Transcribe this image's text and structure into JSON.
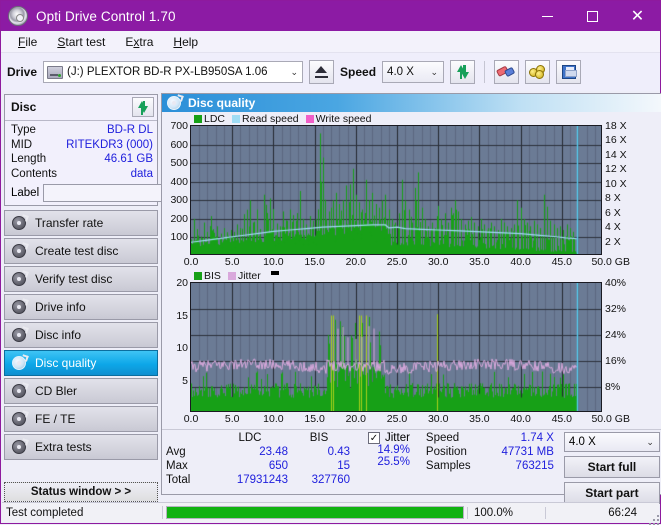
{
  "window": {
    "title": "Opti Drive Control 1.70",
    "icon": "disc-icon",
    "minimize_label": "minimize",
    "maximize_label": "maximize",
    "close_label": "close",
    "accent_color": "#8c1ba4"
  },
  "menu": {
    "items": [
      {
        "label": "File",
        "mnemonic": "F"
      },
      {
        "label": "Start test",
        "mnemonic": "S"
      },
      {
        "label": "Extra",
        "mnemonic": "x"
      },
      {
        "label": "Help",
        "mnemonic": "H"
      }
    ]
  },
  "toolbar": {
    "drive_label": "Drive",
    "drive_value": "(J:)   PLEXTOR BD-R  PX-LB950SA 1.06",
    "eject_title": "Eject",
    "speed_label": "Speed",
    "speed_value": "4.0 X",
    "refresh_title": "Refresh",
    "erase_title": "Erase disc",
    "coins_title": "Bitsetting",
    "save_title": "Save"
  },
  "sidebar": {
    "disc_panel": {
      "title": "Disc",
      "refresh_icon": "refresh-icon",
      "rows": [
        {
          "key": "Type",
          "value": "BD-R DL"
        },
        {
          "key": "MID",
          "value": "RITEKDR3 (000)"
        },
        {
          "key": "Length",
          "value": "46.61 GB"
        },
        {
          "key": "Contents",
          "value": "data"
        }
      ],
      "label_key": "Label",
      "label_value": "",
      "label_placeholder": "",
      "disc_icon": "disc-icon"
    },
    "items": [
      {
        "label": "Transfer rate",
        "active": false
      },
      {
        "label": "Create test disc",
        "active": false
      },
      {
        "label": "Verify test disc",
        "active": false
      },
      {
        "label": "Drive info",
        "active": false
      },
      {
        "label": "Disc info",
        "active": false
      },
      {
        "label": "Disc quality",
        "active": true
      },
      {
        "label": "CD Bler",
        "active": false
      },
      {
        "label": "FE / TE",
        "active": false
      },
      {
        "label": "Extra tests",
        "active": false
      }
    ],
    "status_window_button": "Status window > >"
  },
  "panel": {
    "title": "Disc quality",
    "icon": "disc-quality-icon"
  },
  "stats": {
    "columns": [
      "LDC",
      "BIS"
    ],
    "rows": [
      {
        "label": "Avg",
        "ldc": "23.48",
        "bis": "0.43",
        "jitter": "14.9%"
      },
      {
        "label": "Max",
        "ldc": "650",
        "bis": "15",
        "jitter": "25.5%"
      },
      {
        "label": "Total",
        "ldc": "17931243",
        "bis": "327760",
        "jitter": ""
      }
    ],
    "jitter_label": "Jitter",
    "jitter_checked": true,
    "jitter_check_glyph": "✓",
    "speed_label": "Speed",
    "speed_value": "1.74 X",
    "position_label": "Position",
    "position_value": "47731 MB",
    "samples_label": "Samples",
    "samples_value": "763215",
    "speed_select_value": "4.0 X",
    "start_full_label": "Start full",
    "start_part_label": "Start part"
  },
  "statusbar": {
    "text": "Test completed",
    "progress_percent": 100.0,
    "percent_label": "100.0%",
    "elapsed": "66:24"
  },
  "chart_data": [
    {
      "id": "ldc-chart",
      "type": "area",
      "title": "",
      "xlabel": "GB",
      "ylabel": "LDC",
      "xlim": [
        0,
        50
      ],
      "ylim": [
        0,
        700
      ],
      "y2lim": [
        0,
        18
      ],
      "y2label": "X",
      "grid": true,
      "legend_position": "top-left",
      "legend": [
        {
          "name": "LDC",
          "color": "#17a017"
        },
        {
          "name": "Read speed",
          "color": "#9fdcf4"
        },
        {
          "name": "Write speed",
          "color": "#f060c8"
        }
      ],
      "xticks": [
        "0.0",
        "5.0",
        "10.0",
        "15.0",
        "20.0",
        "25.0",
        "30.0",
        "35.0",
        "40.0",
        "45.0",
        "50.0 GB"
      ],
      "yticks": [
        "700",
        "600",
        "500",
        "400",
        "300",
        "200",
        "100"
      ],
      "y2ticks": [
        "18 X",
        "16 X",
        "14 X",
        "12 X",
        "10 X",
        "8 X",
        "6 X",
        "4 X",
        "2 X"
      ],
      "plot_background": "#6b7b95",
      "series": [
        {
          "name": "LDC",
          "color": "#17a017",
          "render": "spikes",
          "x": [
            0.0,
            0.4,
            0.8,
            1.2,
            1.6,
            2.0,
            2.4,
            2.8,
            3.2,
            3.6,
            4.0,
            4.4,
            4.8,
            5.2,
            5.6,
            6.0,
            6.4,
            6.8,
            7.2,
            7.6,
            8.0,
            8.4,
            8.8,
            9.2,
            9.6,
            10.0,
            10.4,
            10.8,
            11.2,
            11.6,
            12.0,
            12.4,
            12.8,
            13.2,
            13.6,
            14.0,
            14.4,
            14.8,
            15.2,
            15.6,
            16.0,
            16.4,
            16.8,
            17.0,
            17.2,
            17.6,
            18.0,
            18.4,
            18.8,
            19.2,
            19.6,
            20.0,
            20.4,
            20.8,
            21.2,
            21.6,
            22.0,
            22.4,
            22.8,
            23.2,
            23.6,
            24.0,
            24.4,
            24.8,
            25.2,
            25.6,
            26.0,
            26.4,
            26.8,
            27.2,
            27.6,
            28.0,
            28.4,
            28.8,
            29.2,
            29.6,
            30.0,
            30.4,
            30.8,
            31.2,
            31.6,
            32.0,
            32.4,
            32.8,
            33.2,
            33.6,
            34.0,
            34.4,
            34.8,
            35.2,
            35.6,
            36.0,
            36.4,
            36.8,
            37.2,
            37.6,
            38.0,
            38.4,
            38.8,
            39.2,
            39.6,
            40.0,
            40.4,
            40.8,
            41.2,
            41.6,
            42.0,
            42.4,
            42.8,
            43.2,
            43.6,
            44.0,
            44.4,
            44.8,
            45.2,
            45.6,
            46.0,
            46.4,
            46.8
          ],
          "baseline": [
            70,
            75,
            70,
            68,
            72,
            70,
            75,
            72,
            78,
            74,
            80,
            76,
            82,
            80,
            84,
            82,
            86,
            84,
            88,
            86,
            90,
            92,
            88,
            94,
            92,
            96,
            98,
            95,
            100,
            102,
            105,
            103,
            108,
            106,
            110,
            112,
            115,
            118,
            120,
            122,
            125,
            130,
            128,
            135,
            140,
            138,
            142,
            145,
            148,
            150,
            152,
            155,
            158,
            160,
            162,
            165,
            168,
            170,
            172,
            175,
            60,
            70,
            68,
            72,
            70,
            66,
            68,
            72,
            70,
            66,
            68,
            64,
            66,
            62,
            64,
            60,
            62,
            58,
            60,
            62,
            58,
            60,
            56,
            58,
            54,
            56,
            52,
            54,
            50,
            52,
            48,
            50,
            46,
            48,
            44,
            46,
            42,
            44,
            40,
            42,
            38,
            40,
            36,
            38,
            34,
            36,
            32,
            34,
            30,
            32,
            28,
            30,
            26,
            28,
            24,
            26,
            22,
            24,
            20
          ],
          "peaks": [
            90,
            200,
            110,
            105,
            180,
            130,
            215,
            125,
            160,
            118,
            150,
            128,
            140,
            130,
            170,
            150,
            225,
            140,
            300,
            160,
            250,
            145,
            330,
            190,
            310,
            200,
            175,
            160,
            240,
            190,
            250,
            220,
            190,
            350,
            200,
            170,
            215,
            190,
            200,
            660,
            530,
            200,
            240,
            260,
            300,
            340,
            280,
            300,
            380,
            290,
            470,
            330,
            290,
            250,
            410,
            300,
            340,
            280,
            260,
            300,
            330,
            250,
            200,
            180,
            230,
            410,
            300,
            250,
            180,
            210,
            450,
            260,
            200,
            160,
            180,
            150,
            270,
            200,
            230,
            180,
            260,
            300,
            240,
            200,
            170,
            190,
            210,
            180,
            160,
            200,
            170,
            150,
            180,
            160,
            140,
            200,
            180,
            160,
            150,
            170,
            300,
            260,
            200,
            180,
            160,
            190,
            170,
            150,
            330,
            200,
            190,
            170,
            150,
            160,
            140,
            170,
            150,
            130,
            120
          ]
        },
        {
          "name": "Read speed",
          "color": "#9fdcf4",
          "render": "line",
          "x": [
            0.0,
            2.0,
            4.0,
            6.0,
            8.0,
            10.0,
            12.0,
            14.0,
            16.0,
            18.0,
            20.0,
            22.0,
            23.6,
            24.0,
            25.0,
            26.0,
            28.0,
            30.0,
            32.0,
            34.0,
            36.0,
            38.0,
            40.0,
            42.0,
            44.0,
            45.5,
            46.8,
            46.9
          ],
          "y_speed": [
            1.9,
            2.2,
            2.5,
            2.8,
            3.1,
            3.4,
            3.6,
            3.8,
            4.0,
            4.1,
            4.2,
            4.3,
            4.3,
            3.9,
            4.0,
            3.8,
            3.7,
            3.6,
            3.5,
            3.4,
            3.3,
            3.2,
            3.1,
            2.9,
            2.7,
            2.5,
            2.4,
            18.0
          ]
        }
      ],
      "cursor_marker": {
        "x": 46.9,
        "color": "#55cdf0"
      }
    },
    {
      "id": "bis-jitter-chart",
      "type": "area",
      "title": "",
      "xlabel": "GB",
      "ylabel": "BIS",
      "xlim": [
        0,
        50
      ],
      "ylim": [
        0,
        20
      ],
      "y2lim": [
        0,
        40
      ],
      "y2label": "%",
      "grid": true,
      "legend_position": "top-left",
      "legend": [
        {
          "name": "BIS",
          "color": "#17a017"
        },
        {
          "name": "Jitter",
          "color": "#d9a8dc"
        }
      ],
      "xticks": [
        "0.0",
        "5.0",
        "10.0",
        "15.0",
        "20.0",
        "25.0",
        "30.0",
        "35.0",
        "40.0",
        "45.0",
        "50.0 GB"
      ],
      "yticks": [
        "20",
        "15",
        "10",
        "5"
      ],
      "y2ticks": [
        "40%",
        "32%",
        "24%",
        "16%",
        "8%"
      ],
      "plot_background": "#6b7b95",
      "series": [
        {
          "name": "BIS",
          "color": "#17a017",
          "render": "spikes",
          "baseline_level": 4.2,
          "peak_level": 5.2,
          "noisy_region": [
            16.5,
            23.5
          ],
          "noisy_peak_level": 9.0
        },
        {
          "name": "Jitter",
          "color": "#d9a8dc",
          "render": "line",
          "avg_percent": 14.9,
          "max_percent": 25.5,
          "band_low": 13.0,
          "band_high": 17.0
        }
      ],
      "cursor_marker": {
        "x": 46.9,
        "color": "#55cdf0"
      }
    }
  ]
}
